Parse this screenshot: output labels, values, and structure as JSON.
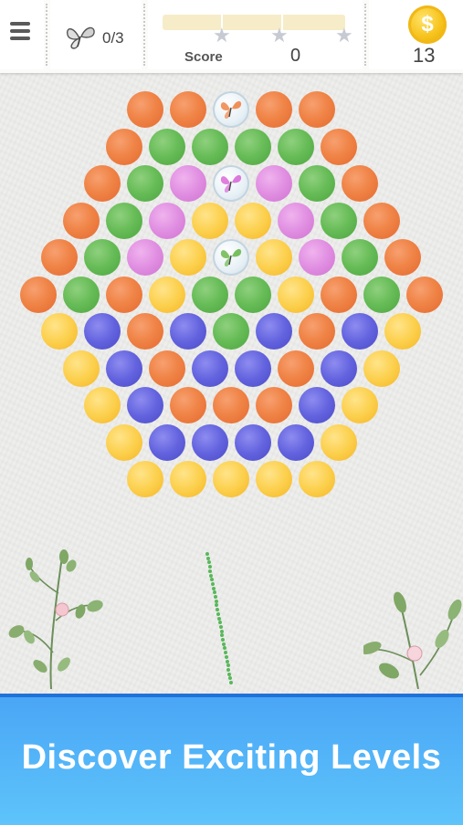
{
  "header": {
    "butterfly_counter": "0/3",
    "score_label": "Score",
    "score_value": "0",
    "coin_symbol": "$",
    "coin_count": "13",
    "progress_fraction": 0,
    "stars_earned": 0,
    "stars_total": 3
  },
  "board": {
    "rows": [
      [
        "orange",
        "orange",
        "butterfly",
        "orange",
        "orange"
      ],
      [
        "orange",
        "green",
        "green",
        "green",
        "green",
        "orange"
      ],
      [
        "orange",
        "green",
        "pink",
        "butterfly",
        "pink",
        "green",
        "orange"
      ],
      [
        "orange",
        "green",
        "pink",
        "yellow",
        "yellow",
        "pink",
        "green",
        "orange"
      ],
      [
        "orange",
        "green",
        "pink",
        "yellow",
        "butterfly",
        "yellow",
        "pink",
        "green",
        "orange"
      ],
      [
        "orange",
        "green",
        "orange",
        "yellow",
        "green",
        "green",
        "yellow",
        "orange",
        "green",
        "orange"
      ],
      [
        "yellow",
        "blue",
        "orange",
        "blue",
        "green",
        "blue",
        "orange",
        "blue",
        "yellow"
      ],
      [
        "yellow",
        "blue",
        "orange",
        "blue",
        "blue",
        "orange",
        "blue",
        "yellow"
      ],
      [
        "yellow",
        "blue",
        "orange",
        "orange",
        "orange",
        "blue",
        "yellow"
      ],
      [
        "yellow",
        "blue",
        "blue",
        "blue",
        "blue",
        "yellow"
      ],
      [
        "yellow",
        "yellow",
        "yellow",
        "yellow",
        "yellow"
      ]
    ],
    "butterfly_colors": [
      "#f08447",
      "#d96ad8",
      "#6bb84e"
    ]
  },
  "colors": {
    "orange": "#f08447",
    "green": "#65bb55",
    "pink": "#e08ee1",
    "yellow": "#fcd04d",
    "blue": "#6363df",
    "aim_line": "#58b85a",
    "banner": "#4aa6f6"
  },
  "banner": {
    "text": "Discover Exciting Levels"
  }
}
